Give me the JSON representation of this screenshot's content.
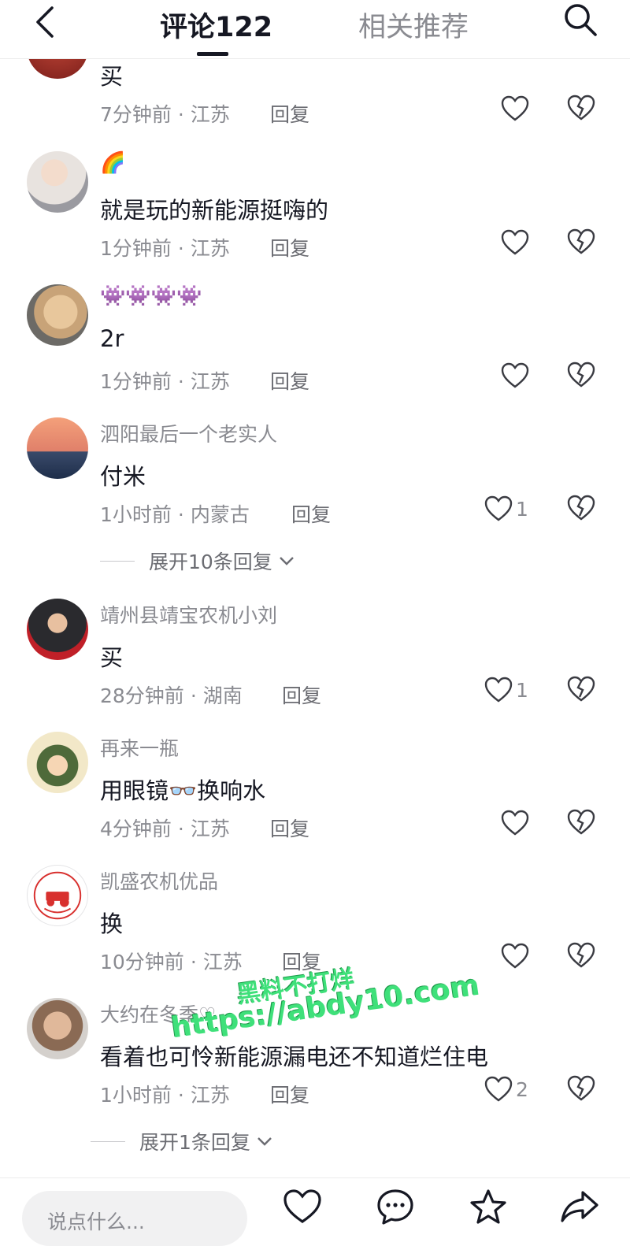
{
  "header": {
    "tab_comments": "评论122",
    "tab_related": "相关推荐"
  },
  "comments": [
    {
      "username": "",
      "text": "买",
      "time": "7分钟前",
      "location": "江苏",
      "reply": "回复",
      "likes": ""
    },
    {
      "username": "🌈",
      "text": "就是玩的新能源挺嗨的",
      "time": "1分钟前",
      "location": "江苏",
      "reply": "回复",
      "likes": ""
    },
    {
      "username": "👾👾👾👾",
      "text": "2r",
      "time": "1分钟前",
      "location": "江苏",
      "reply": "回复",
      "likes": ""
    },
    {
      "username": "泗阳最后一个老实人",
      "text": "付米",
      "time": "1小时前",
      "location": "内蒙古",
      "reply": "回复",
      "likes": "1",
      "expand": "展开10条回复"
    },
    {
      "username": "靖州县靖宝农机小刘",
      "text": "买",
      "time": "28分钟前",
      "location": "湖南",
      "reply": "回复",
      "likes": "1"
    },
    {
      "username": "再来一瓶",
      "text": "用眼镜👓换响水",
      "time": "4分钟前",
      "location": "江苏",
      "reply": "回复",
      "likes": ""
    },
    {
      "username": "凯盛农机优品",
      "text": "换",
      "time": "10分钟前",
      "location": "江苏",
      "reply": "回复",
      "likes": ""
    },
    {
      "username": "大约在冬季♡",
      "text": "看着也可怜新能源漏电还不知道烂住电",
      "time": "1小时前",
      "location": "江苏",
      "reply": "回复",
      "likes": "2",
      "expand": "展开1条回复"
    }
  ],
  "bottom_bar": {
    "input_placeholder": "说点什么..."
  },
  "watermark": {
    "line1": "黑料不打烊",
    "line2": "https://abdy10.com"
  },
  "colors": {
    "text_primary": "#161823",
    "text_secondary": "#8a8b91",
    "watermark": "#3fe07a"
  }
}
